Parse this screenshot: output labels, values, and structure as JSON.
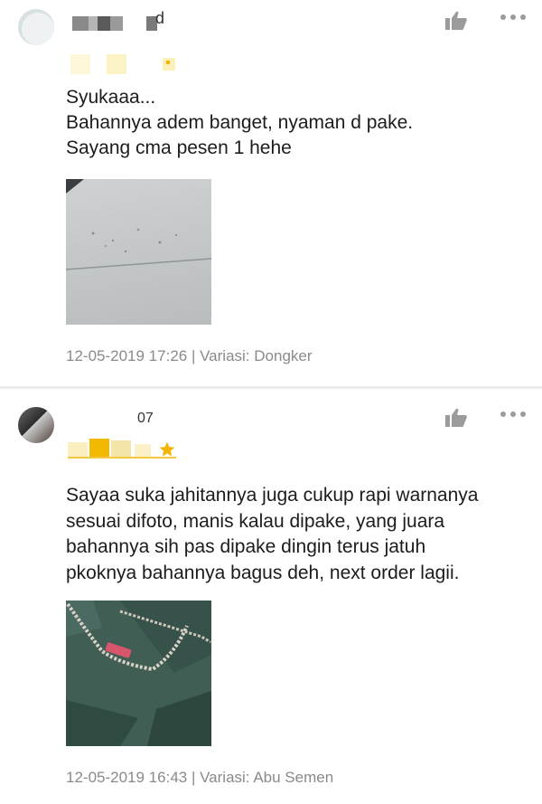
{
  "reviews": [
    {
      "username_fragment": "d",
      "rating": 5,
      "comment": "Syukaaa...\nBahannya adem banget, nyaman d pake.\nSayang cma pesen 1 hehe",
      "date": "12-05-2019 17:26",
      "variant_label": "Variasi: Dongker",
      "photo_icon": "fabric-photo",
      "like_icon": "thumbs-up-icon",
      "more_icon": "more-icon"
    },
    {
      "username_fragment": "07",
      "rating": 5,
      "comment": "Sayaa suka jahitannya juga cukup rapi warnanya\nsesuai difoto, manis kalau dipake, yang juara\nbahannya sih pas dipake dingin terus jatuh\npkoknya bahannya bagus deh, next order lagii.",
      "date": "12-05-2019 16:43",
      "variant_label": "Variasi: Abu Semen",
      "photo_icon": "fabric-photo",
      "like_icon": "thumbs-up-icon",
      "more_icon": "more-icon"
    }
  ],
  "colors": {
    "star": "#f5b400",
    "icon": "#9b9b9b",
    "meta_text": "#8a8a8a",
    "divider": "#ececec"
  }
}
